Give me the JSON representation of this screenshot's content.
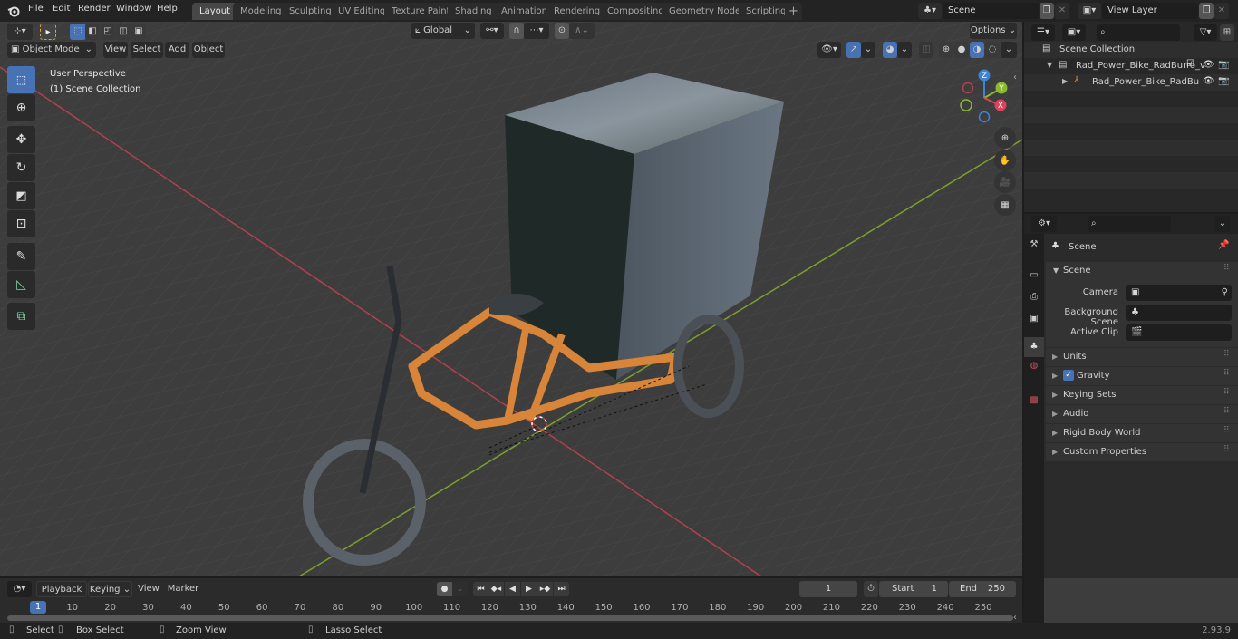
{
  "app": {
    "version": "2.93.9"
  },
  "menu": [
    "File",
    "Edit",
    "Render",
    "Window",
    "Help"
  ],
  "workspace_tabs": [
    {
      "label": "Layout",
      "active": true
    },
    {
      "label": "Modeling"
    },
    {
      "label": "Sculpting"
    },
    {
      "label": "UV Editing"
    },
    {
      "label": "Texture Paint"
    },
    {
      "label": "Shading"
    },
    {
      "label": "Animation"
    },
    {
      "label": "Rendering"
    },
    {
      "label": "Compositing"
    },
    {
      "label": "Geometry Nodes"
    },
    {
      "label": "Scripting"
    }
  ],
  "add_workspace_label": "+",
  "scene_selector": {
    "value": "Scene"
  },
  "view_layer_selector": {
    "value": "View Layer"
  },
  "viewport": {
    "mode": "Object Mode",
    "menus": [
      "View",
      "Select",
      "Add",
      "Object"
    ],
    "transform_orientation": "Global",
    "options_label": "Options",
    "overlay_title": "User Perspective",
    "overlay_subtitle": "(1) Scene Collection",
    "gizmo_axes": {
      "x": "X",
      "y": "Y",
      "z": "Z"
    },
    "axis_colors": {
      "x": "#d9455a",
      "y": "#8bb82e",
      "z": "#3f83d6"
    }
  },
  "tools": [
    "select-box",
    "cursor",
    "move",
    "rotate",
    "scale",
    "transform",
    "annotate",
    "measure",
    "add-cube"
  ],
  "outliner": {
    "search_placeholder": "",
    "root": "Scene Collection",
    "items": [
      {
        "label": "Rad_Power_Bike_RadBurro_v",
        "type": "collection",
        "checked": true
      },
      {
        "label": "Rad_Power_Bike_RadBu",
        "type": "empty"
      }
    ]
  },
  "properties": {
    "search_placeholder": "",
    "context_title": "Scene",
    "panel_title": "Scene",
    "fields": [
      {
        "label": "Camera",
        "value": ""
      },
      {
        "label": "Background Scene",
        "value": ""
      },
      {
        "label": "Active Clip",
        "value": ""
      }
    ],
    "subpanels": [
      {
        "label": "Units"
      },
      {
        "label": "Gravity",
        "checkbox": true
      },
      {
        "label": "Keying Sets"
      },
      {
        "label": "Audio"
      },
      {
        "label": "Rigid Body World"
      },
      {
        "label": "Custom Properties"
      }
    ]
  },
  "timeline": {
    "menus": [
      "Playback",
      "Keying",
      "View",
      "Marker"
    ],
    "current_frame": "1",
    "start_label": "Start",
    "start": "1",
    "end_label": "End",
    "end": "250",
    "playhead": "1",
    "ticks": [
      "10",
      "20",
      "30",
      "40",
      "50",
      "60",
      "70",
      "80",
      "90",
      "100",
      "110",
      "120",
      "130",
      "140",
      "150",
      "160",
      "170",
      "180",
      "190",
      "200",
      "210",
      "220",
      "230",
      "240",
      "250"
    ]
  },
  "statusbar": {
    "select": "Select",
    "box_select": "Box Select",
    "zoom_view": "Zoom View",
    "lasso_select": "Lasso Select"
  }
}
